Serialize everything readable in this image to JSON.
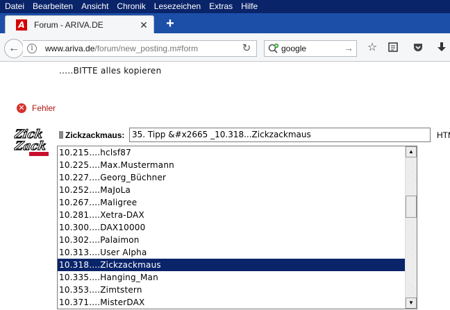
{
  "menu": [
    "Datei",
    "Bearbeiten",
    "Ansicht",
    "Chronik",
    "Lesezeichen",
    "Extras",
    "Hilfe"
  ],
  "tab": {
    "title": "Forum - ARIVA.DE",
    "favicon_letter": "A"
  },
  "url": {
    "host": "www.ariva.de",
    "path": "/forum/new_posting.m#form"
  },
  "search": {
    "value": "google"
  },
  "page": {
    "copy_hint": ".....BITTE alles kopieren",
    "error_label": "Fehler",
    "user_label": "Zickzackmaus:",
    "subject_value": "35. Tipp &#x2665  _10.318...Zickzackmaus",
    "html_label": "HTML"
  },
  "list": {
    "items": [
      "10.215....hclsf87",
      "10.225....Max.Mustermann",
      "10.227....Georg_Büchner",
      "10.252....MaJoLa",
      "10.267....Maligree",
      "10.281....Xetra-DAX",
      "10.300....DAX10000",
      "10.302....Palaimon",
      "10.313....User Alpha",
      "10.318....Zickzackmaus",
      "10.335....Hanging_Man",
      "10.353....Zimtstern",
      "10.371....MisterDAX"
    ],
    "selected_index": 9
  },
  "colors": {
    "menubar": "#0a246a",
    "selection": "#0a246a",
    "error": "#b0120d"
  }
}
